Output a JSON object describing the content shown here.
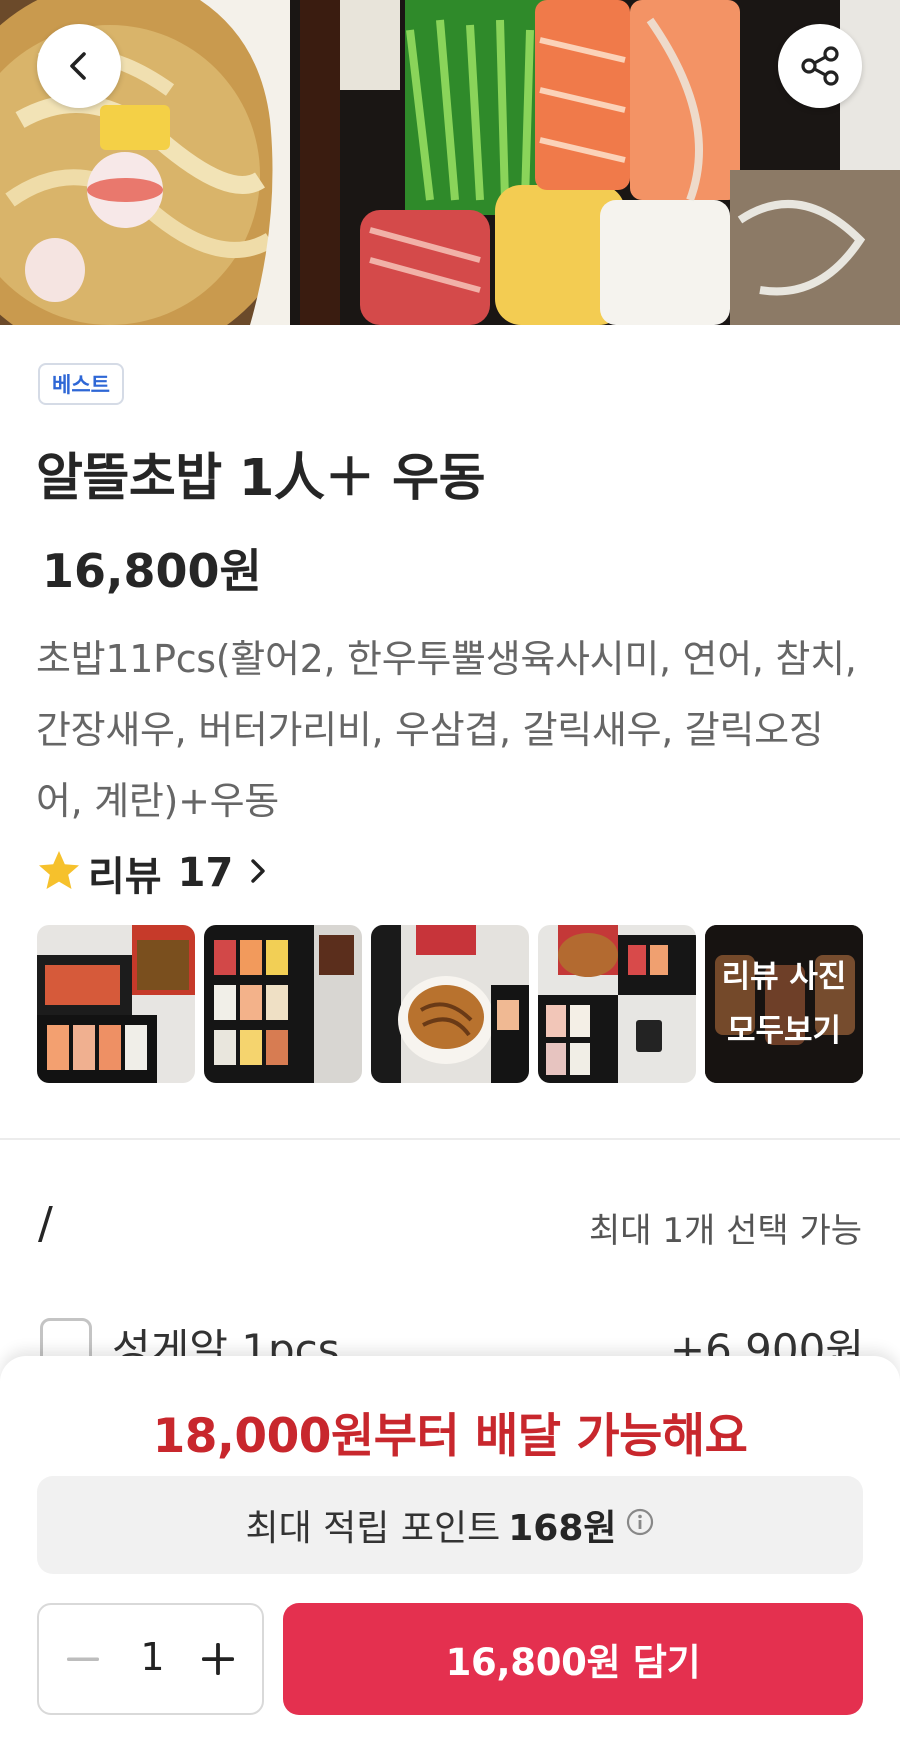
{
  "header": {
    "back_icon": "chevron-left-icon",
    "share_icon": "share-icon"
  },
  "product": {
    "badge": "베스트",
    "title": "알뜰초밥 1人＋ 우동",
    "price": "16,800원",
    "description": "초밥11Pcs(활어2, 한우투뿔생육사시미, 연어, 참치, 간장새우, 버터가리비, 우삼겹, 갈릭새우, 갈릭오징어, 계란)+우동"
  },
  "reviews": {
    "label": "리뷰",
    "count": "17",
    "star_color": "#f6c12c",
    "more_line1": "리뷰 사진",
    "more_line2": "모두보기"
  },
  "options": {
    "title": "/",
    "limit_text": "최대 1개 선택 가능",
    "items": [
      {
        "name": "성게알 1pcs",
        "price": "+6,900원"
      }
    ]
  },
  "bottom_sheet": {
    "min_order_notice": "18,000원부터 배달 가능해요",
    "points_label": "최대 적립 포인트",
    "points_value": "168원",
    "quantity": "1",
    "add_button_label": "16,800원 담기",
    "accent_color": "#e4304f",
    "notice_color": "#c8272d"
  }
}
